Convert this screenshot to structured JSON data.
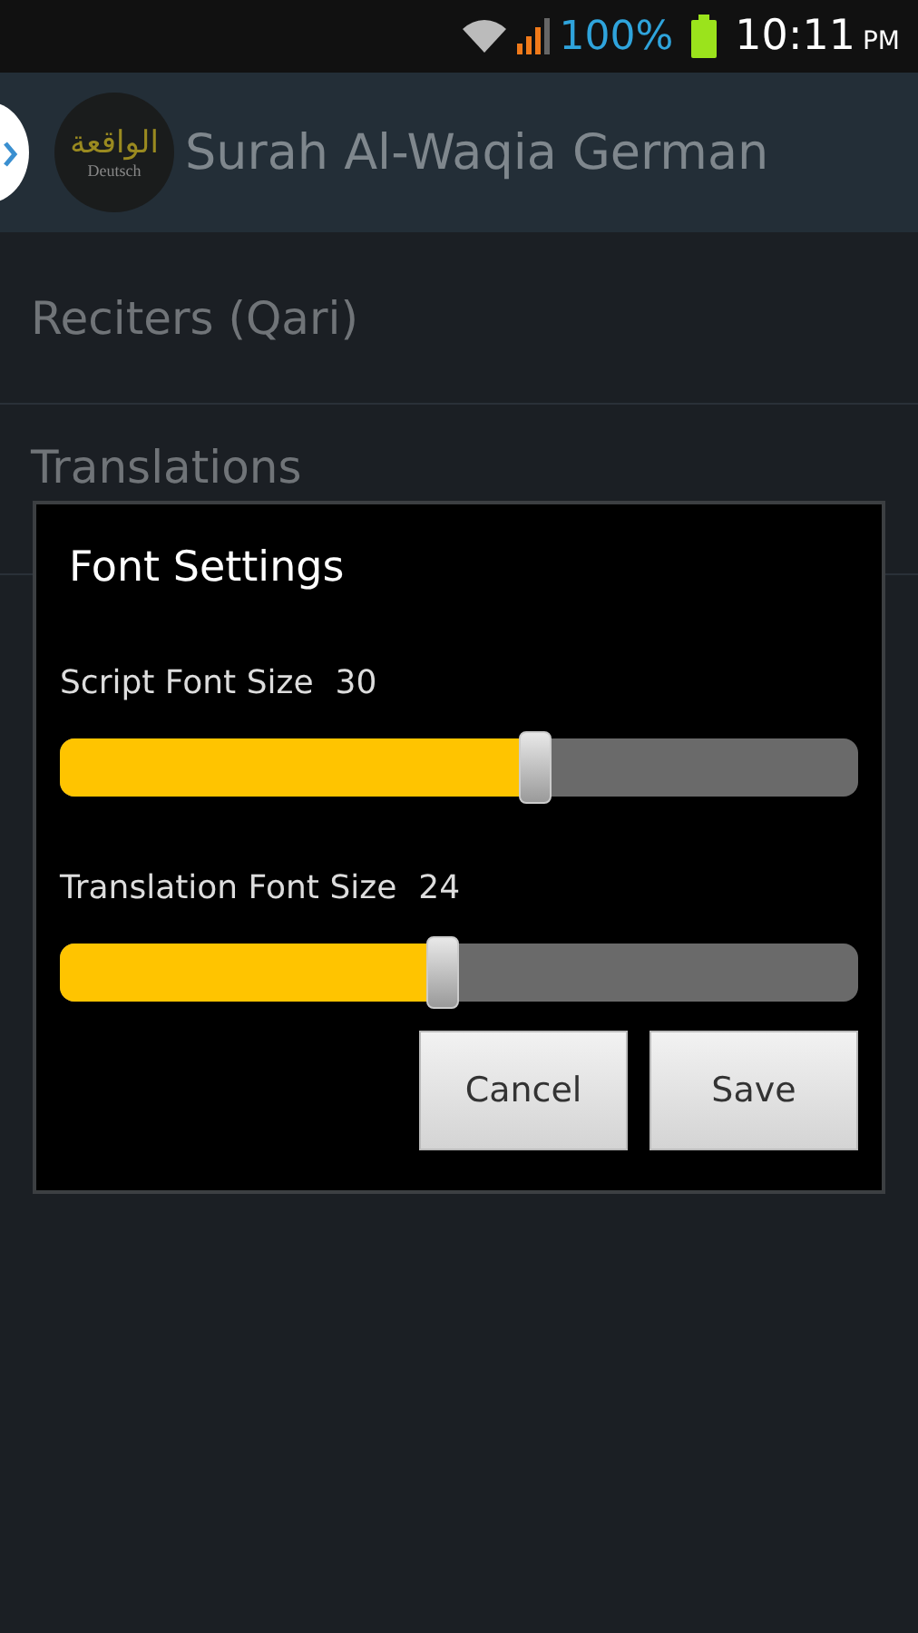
{
  "status_bar": {
    "battery": "100%",
    "time": "10:11",
    "meridiem": "PM"
  },
  "app_bar": {
    "title": "Surah Al-Waqia German",
    "logo": {
      "script": "الواقعة",
      "caption": "Deutsch"
    }
  },
  "menu": [
    {
      "label": "Reciters (Qari)"
    },
    {
      "label": "Translations"
    }
  ],
  "dialog": {
    "title": "Font Settings",
    "sliders": [
      {
        "label": "Script Font Size",
        "value": "30",
        "level": 0.595
      },
      {
        "label": "Translation Font Size",
        "value": "24",
        "level": 0.48
      }
    ],
    "buttons": [
      "Cancel",
      "Save"
    ]
  }
}
